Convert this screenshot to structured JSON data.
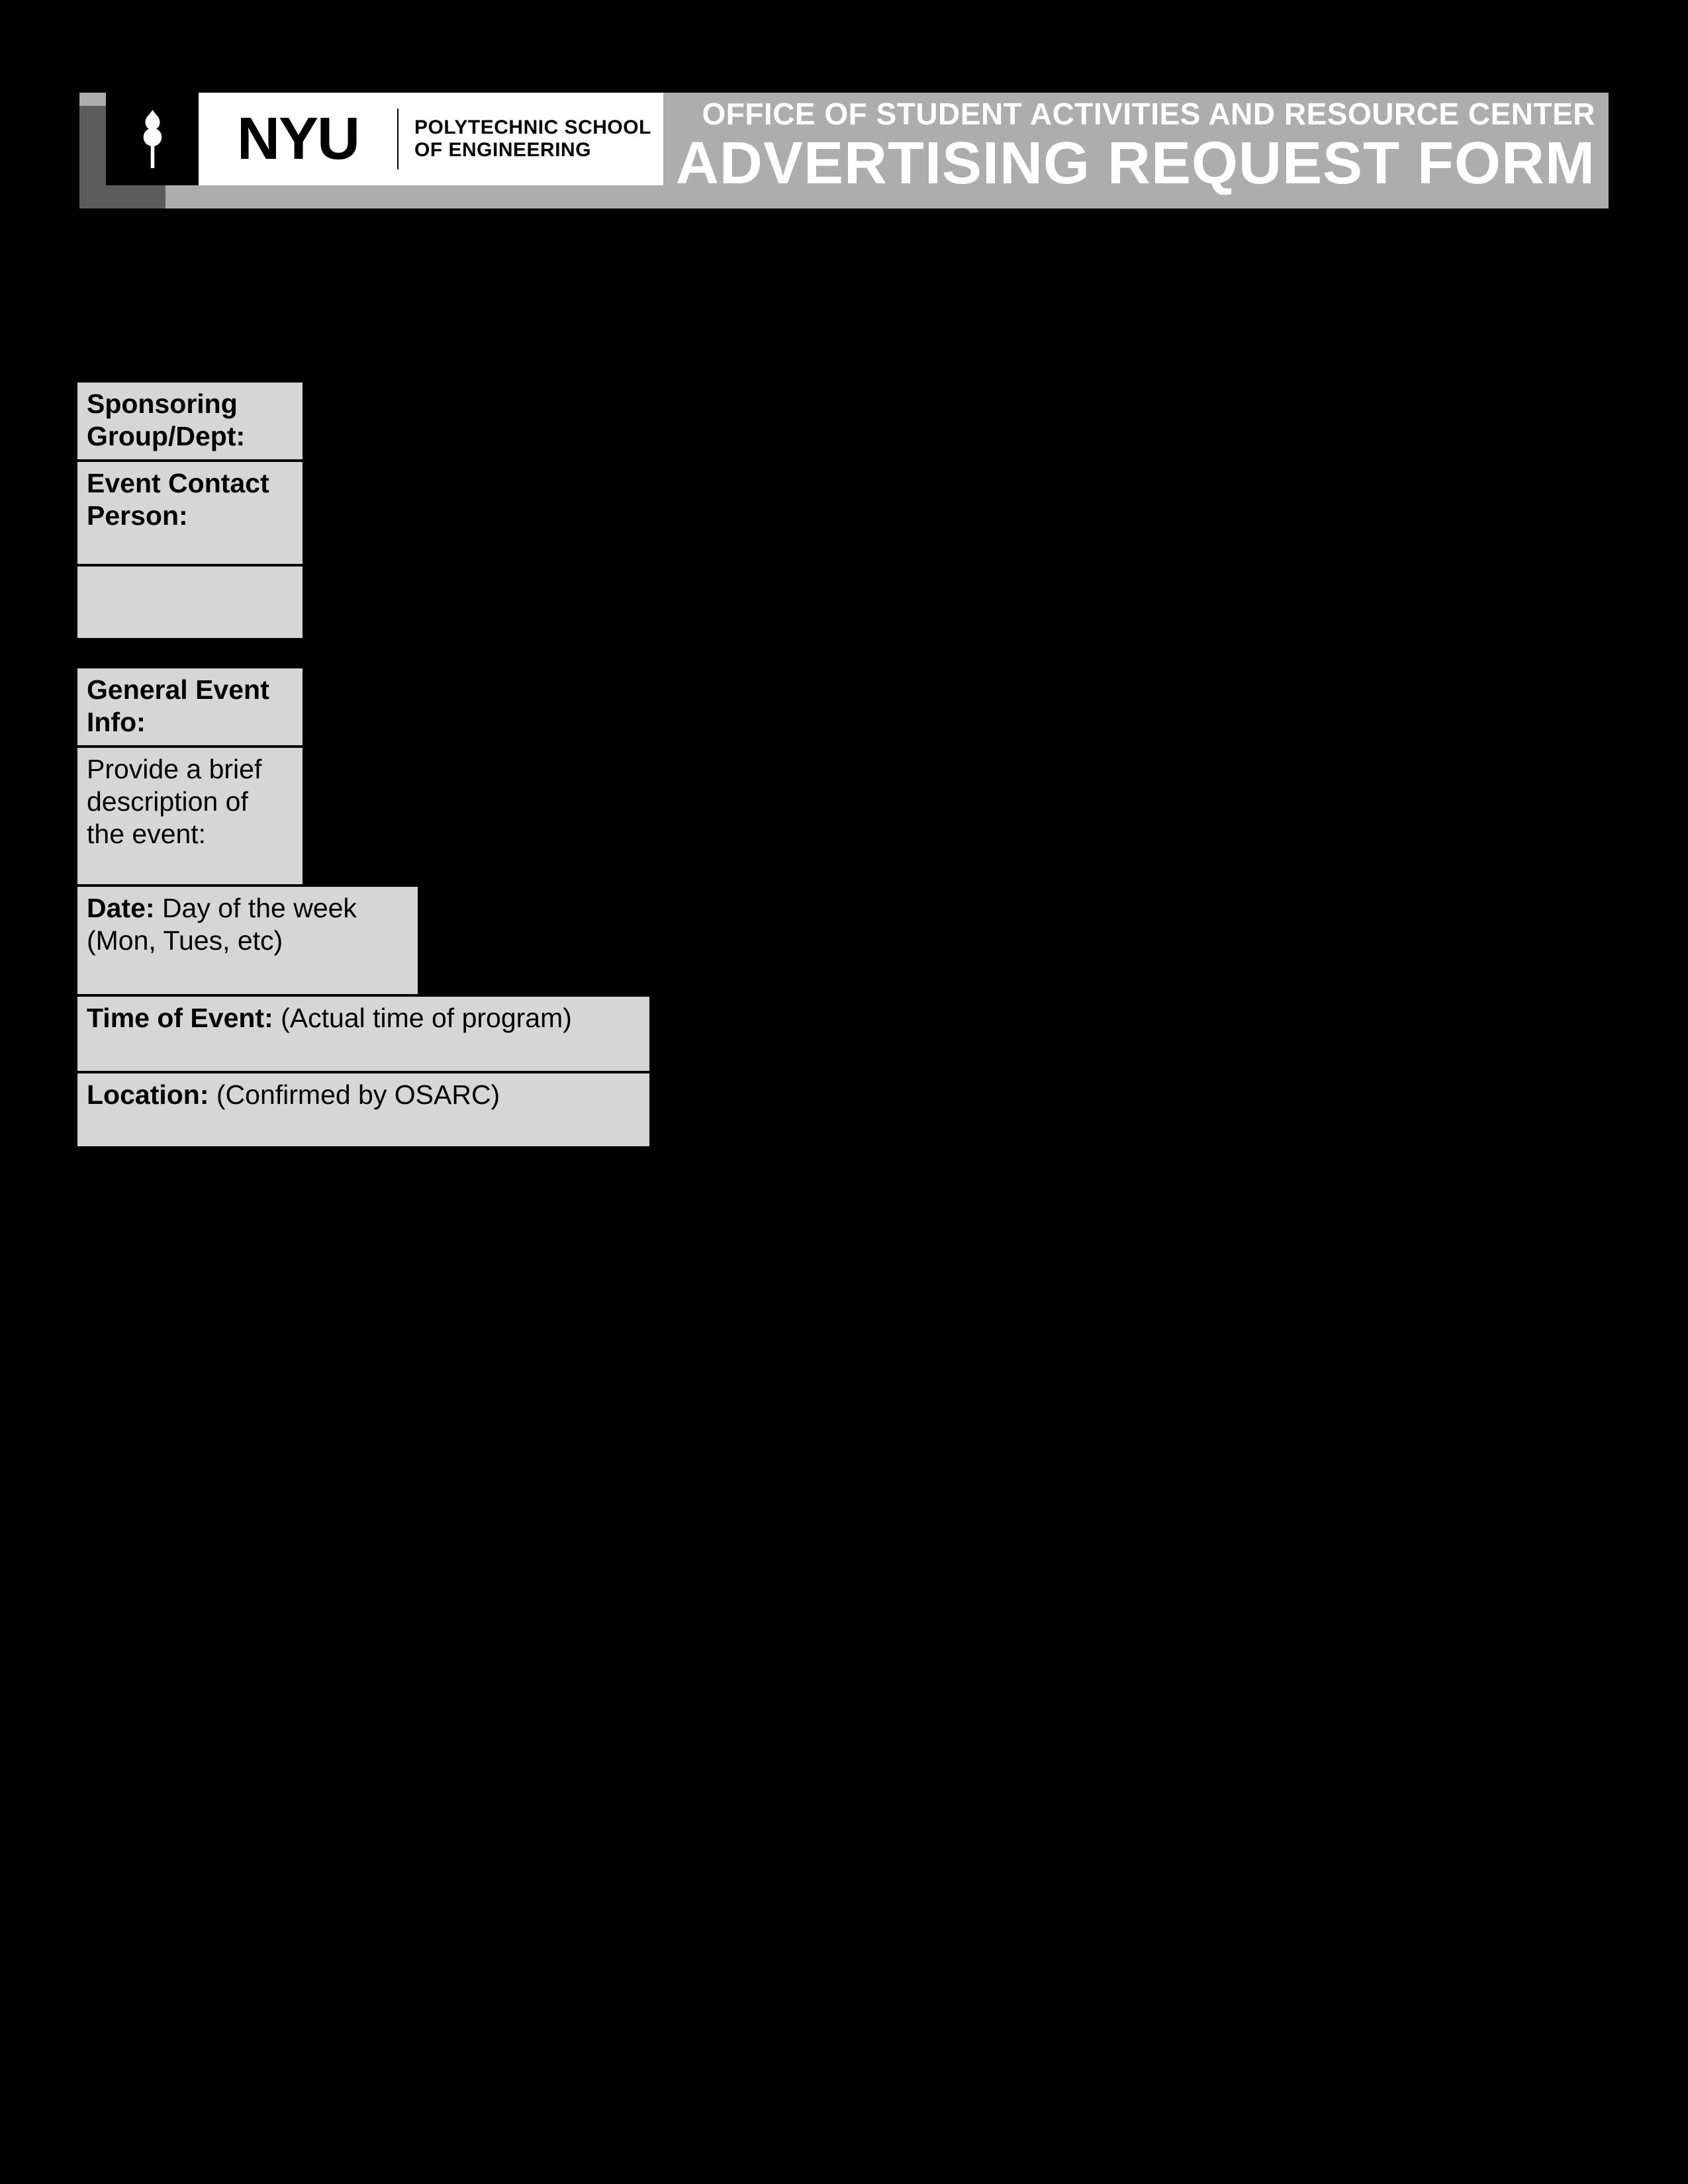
{
  "header": {
    "office_line": "OFFICE OF STUDENT ACTIVITIES AND RESOURCE CENTER",
    "form_title": "ADVERTISING REQUEST FORM",
    "logo_nyu": "NYU",
    "logo_sub_line1": "POLYTECHNIC SCHOOL",
    "logo_sub_line2": "OF ENGINEERING"
  },
  "fields": {
    "sponsoring_label": "Sponsoring Group/Dept:",
    "event_contact_label": "Event Contact Person:",
    "general_info_label": "General Event Info:",
    "description_label": "Provide a brief description of the event:",
    "date_label": "Date:",
    "date_hint": " Day of the week (Mon, Tues, etc)",
    "time_label": "Time of Event:",
    "time_hint": " (Actual time of program)",
    "location_label": "Location:",
    "location_hint": " (Confirmed by OSARC)"
  }
}
